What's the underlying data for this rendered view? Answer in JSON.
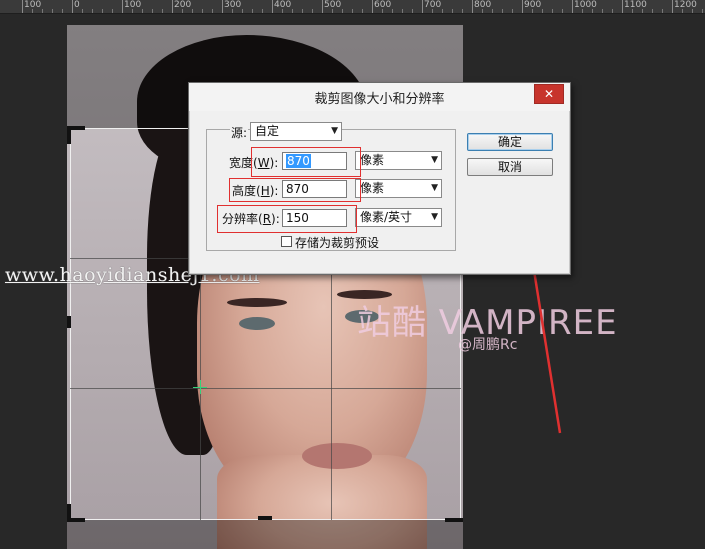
{
  "ruler": {
    "labels": [
      "100",
      "0",
      "100",
      "200",
      "300",
      "400",
      "500",
      "600",
      "700",
      "800",
      "900",
      "1000",
      "1100",
      "1200"
    ]
  },
  "watermark": {
    "url": "www.haoyidianshej1.com",
    "brand": "站酷 VAMPIREE",
    "author": "@周鹏Rc"
  },
  "dialog": {
    "title": "裁剪图像大小和分辨率",
    "close": "✕",
    "source_label": "源:",
    "source_value": "自定",
    "width_label": "宽度",
    "width_key": "W",
    "width_value": "870",
    "width_unit": "像素",
    "height_label": "高度",
    "height_key": "H",
    "height_value": "870",
    "height_unit": "像素",
    "resolution_label": "分辨率",
    "resolution_key": "R",
    "resolution_value": "150",
    "resolution_unit": "像素/英寸",
    "save_preset_label": "存储为裁剪预设",
    "save_preset_checked": false,
    "ok_label": "确定",
    "cancel_label": "取消"
  },
  "colors": {
    "annotation_red": "#e03030",
    "close_red": "#c7342c",
    "selection_blue": "#3399ff"
  }
}
